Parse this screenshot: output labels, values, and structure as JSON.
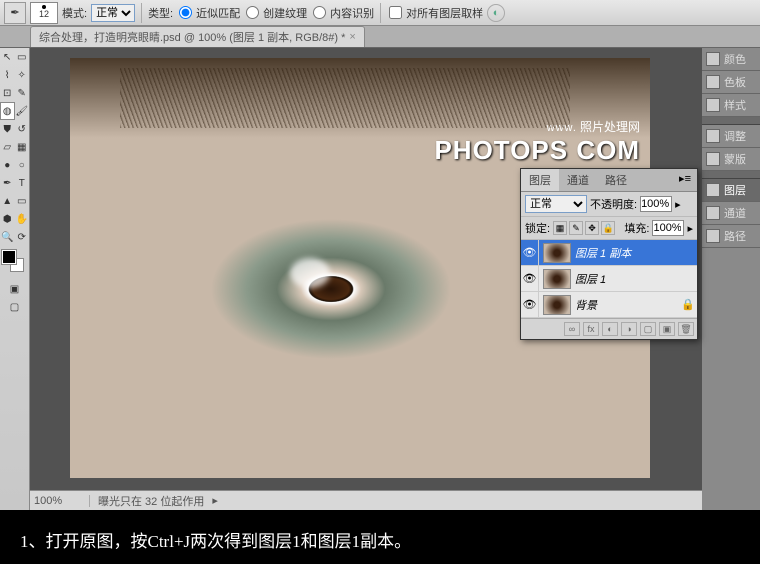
{
  "options_bar": {
    "brush_size": "12",
    "mode_label": "模式:",
    "mode_value": "正常",
    "type_label": "类型:",
    "radio1": "近似匹配",
    "radio2": "创建纹理",
    "radio3": "内容识别",
    "checkbox1": "对所有图层取样"
  },
  "tab": {
    "title": "综合处理，打造明亮眼睛.psd @ 100% (图层 1 副本, RGB/8#) *"
  },
  "watermark": {
    "www": "www.",
    "main": "PHOTOPS COM",
    "cn": "照片处理网"
  },
  "right_panels": {
    "items": [
      "颜色",
      "色板",
      "样式",
      "调整",
      "蒙版",
      "图层",
      "通道",
      "路径"
    ]
  },
  "layers_panel": {
    "tabs": [
      "图层",
      "通道",
      "路径"
    ],
    "blend_mode": "正常",
    "opacity_label": "不透明度:",
    "opacity_value": "100%",
    "lock_label": "锁定:",
    "fill_label": "填充:",
    "fill_value": "100%",
    "layers": [
      {
        "name": "图层 1 副本",
        "selected": true,
        "locked": false
      },
      {
        "name": "图层 1",
        "selected": false,
        "locked": false
      },
      {
        "name": "背景",
        "selected": false,
        "locked": true
      }
    ]
  },
  "status": {
    "zoom": "100%",
    "info": "曝光只在 32 位起作用"
  },
  "caption": "1、打开原图，按Ctrl+J两次得到图层1和图层1副本。"
}
